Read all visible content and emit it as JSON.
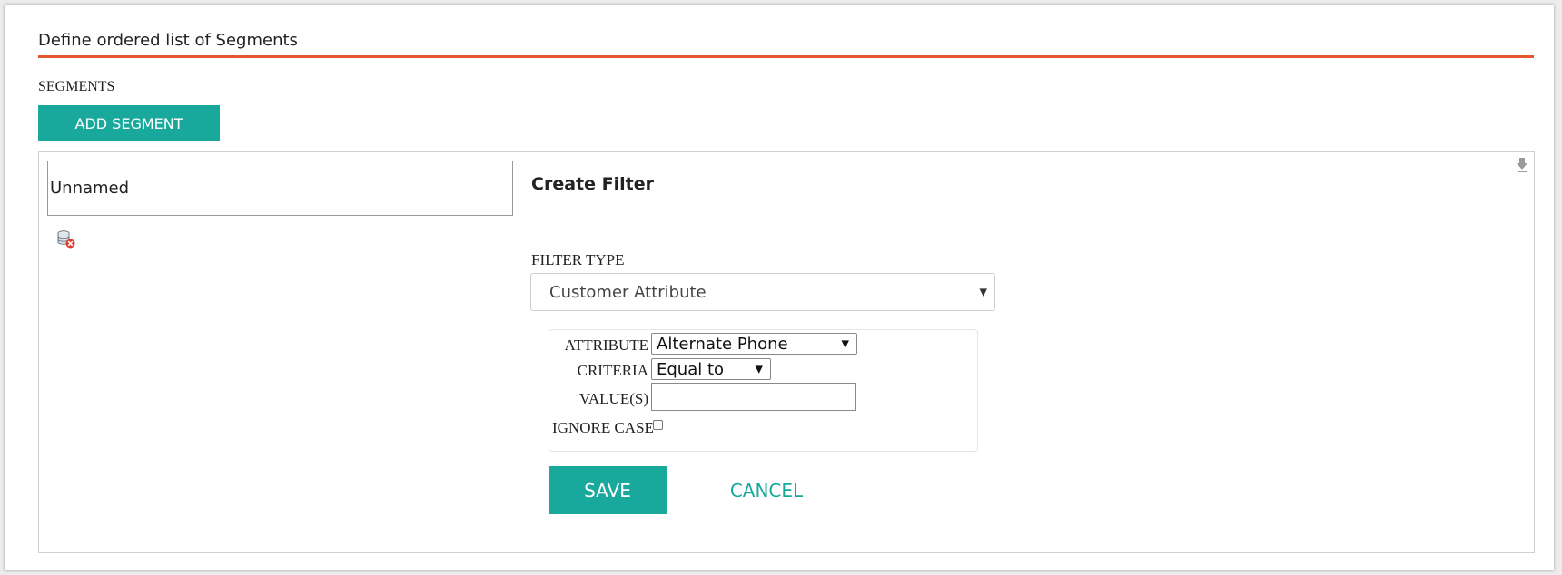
{
  "header": {
    "title": "Define ordered list of Segments"
  },
  "segments": {
    "label": "SEGMENTS",
    "add_button_label": "ADD SEGMENT"
  },
  "segment": {
    "name": "Unnamed",
    "icons": {
      "delete": "database-delete-icon",
      "pin": "pin-icon"
    }
  },
  "filter": {
    "heading": "Create Filter",
    "type_label": "FILTER TYPE",
    "type_value": "Customer Attribute",
    "attribute_label": "ATTRIBUTE",
    "attribute_value": "Alternate Phone",
    "criteria_label": "CRITERIA",
    "criteria_value": "Equal to",
    "values_label": "VALUE(S)",
    "values_value": "",
    "ignore_case_label": "IGNORE CASE",
    "ignore_case_checked": false,
    "save_label": "SAVE",
    "cancel_label": "CANCEL"
  },
  "colors": {
    "accent": "#18a99c",
    "title_rule": "#e4572e"
  }
}
